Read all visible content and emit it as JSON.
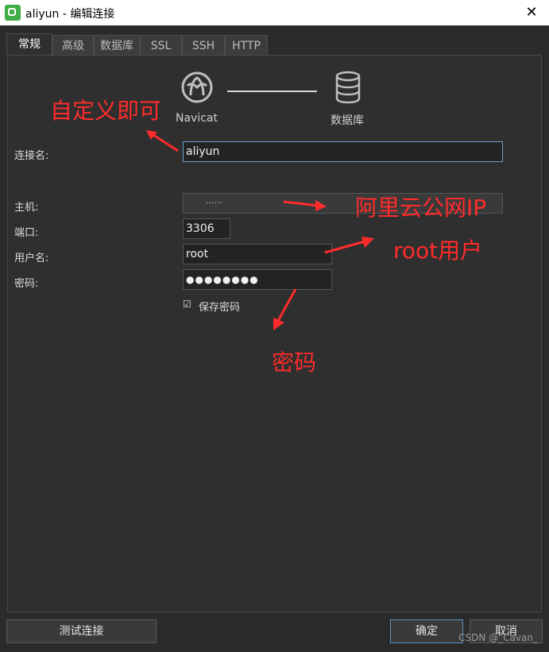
{
  "window": {
    "title": "aliyun - 编辑连接",
    "close_glyph": "✕"
  },
  "tabs": [
    {
      "label": "常规",
      "active": true
    },
    {
      "label": "高级"
    },
    {
      "label": "数据库"
    },
    {
      "label": "SSL"
    },
    {
      "label": "SSH"
    },
    {
      "label": "HTTP"
    }
  ],
  "diagram": {
    "left_label": "Navicat",
    "right_label": "数据库",
    "left_icon": "navicat-logo-icon",
    "right_icon": "database-icon"
  },
  "form": {
    "connection_name": {
      "label": "连接名:",
      "value": "aliyun"
    },
    "host": {
      "label": "主机:",
      "value": "······"
    },
    "port": {
      "label": "端口:",
      "value": "3306"
    },
    "username": {
      "label": "用户名:",
      "value": "root"
    },
    "password": {
      "label": "密码:",
      "value": "●●●●●●●●"
    },
    "save_password": {
      "label": "保存密码",
      "checked": true,
      "check_glyph": "☑"
    }
  },
  "annotations": {
    "name": "自定义即可",
    "host": "阿里云公网IP",
    "user": "root用户",
    "password": "密码",
    "color": "#ff2b2b"
  },
  "buttons": {
    "test": "测试连接",
    "ok": "确定",
    "cancel": "取消"
  },
  "watermark": "CSDN @_Cavan_"
}
